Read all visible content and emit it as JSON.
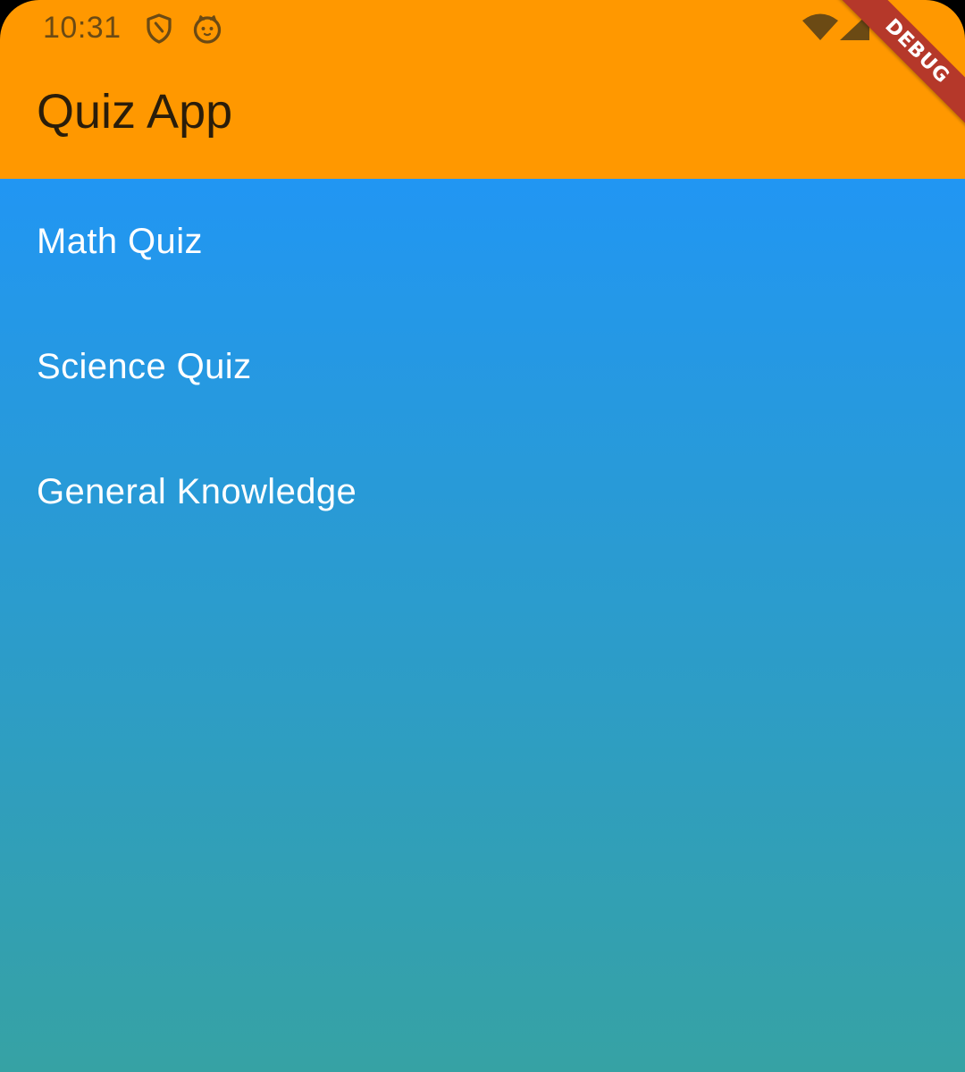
{
  "status_bar": {
    "time": "10:31",
    "icons": [
      "shield-icon",
      "cat-icon",
      "wifi-icon",
      "signal-icon",
      "battery-icon"
    ]
  },
  "app_bar": {
    "title": "Quiz App",
    "color": "#FF9800"
  },
  "debug_banner": {
    "label": "DEBUG",
    "color": "#B5382A"
  },
  "quizzes": [
    {
      "label": "Math Quiz"
    },
    {
      "label": "Science Quiz"
    },
    {
      "label": "General Knowledge"
    }
  ],
  "colors": {
    "gradient_top": "#2196F3",
    "gradient_bottom": "#36A2A4",
    "item_text": "#FFFFFF"
  }
}
